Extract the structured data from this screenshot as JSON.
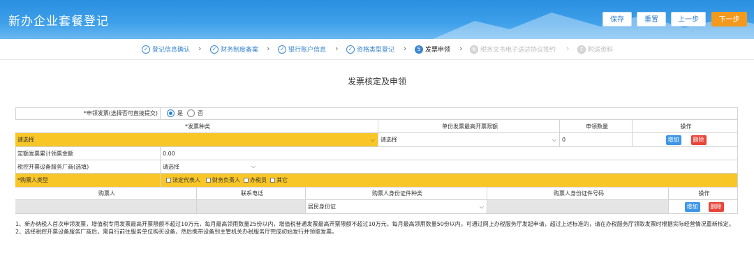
{
  "header": {
    "title": "新办企业套餐登记",
    "buttons": {
      "save": "保存",
      "reset": "重置",
      "prev": "上一步",
      "next": "下一步"
    }
  },
  "steps": [
    {
      "label": "登记信息确认",
      "icon": "✓"
    },
    {
      "label": "财务制度备案",
      "icon": "✓"
    },
    {
      "label": "银行账户信息",
      "icon": "✓"
    },
    {
      "label": "资格类型登记",
      "icon": "✓"
    },
    {
      "label": "发票申领",
      "icon": "5"
    },
    {
      "label": "税务文书电子送达协议签约",
      "icon": "6"
    },
    {
      "label": "附送资料",
      "icon": "7"
    }
  ],
  "section_title": "发票核定及申领",
  "form": {
    "apply_label": "*申领发票(选择否可直接提交)",
    "apply_yes": "是",
    "apply_no": "否",
    "invoice_table": {
      "headers": [
        "*发票种类",
        "单份发票最高开票限额",
        "申领数量",
        "操作"
      ],
      "row": {
        "type": "请选择",
        "limit": "请选择",
        "qty": "0",
        "add": "增加",
        "del": "删除"
      }
    },
    "quota_label": "定额发票累计领票金额",
    "quota_value": "0.00",
    "vendor_label": "税控开票设备服务厂商(选填)",
    "vendor_value": "请选择",
    "buyer_type_label": "*购票人类型",
    "buyer_types": [
      "法定代表人",
      "财务负责人",
      "办税员",
      "其它"
    ],
    "buyer_table": {
      "headers": [
        "购票人",
        "联系电话",
        "购票人身份证件种类",
        "购票人身份证件号码",
        "操作"
      ],
      "row": {
        "id_type": "居民身份证",
        "add": "增加",
        "del": "删除"
      }
    }
  },
  "notes": [
    "1、新办纳税人首次申领发票，增值税专用发票最高开票限额不超过10万元，每月最高领用数量25份以内，增值税普通发票最高开票限额不超过10万元，每月最高领用数量50份以内。可通过网上办税服务厅发起申请，超过上述标准的，请在办税服务厅领取发票时根据实际经营情况重新核定。",
    "2、选择税控开票设备服务厂商后，需自行前往服务单位购买设备，然后携带设备到主管机关办税服务厅完成初始发行并领取发票。"
  ],
  "colors": {
    "accent": "#3a86d0",
    "next": "#f39a1e",
    "highlight": "#f8c627",
    "delete": "#e8463a"
  }
}
